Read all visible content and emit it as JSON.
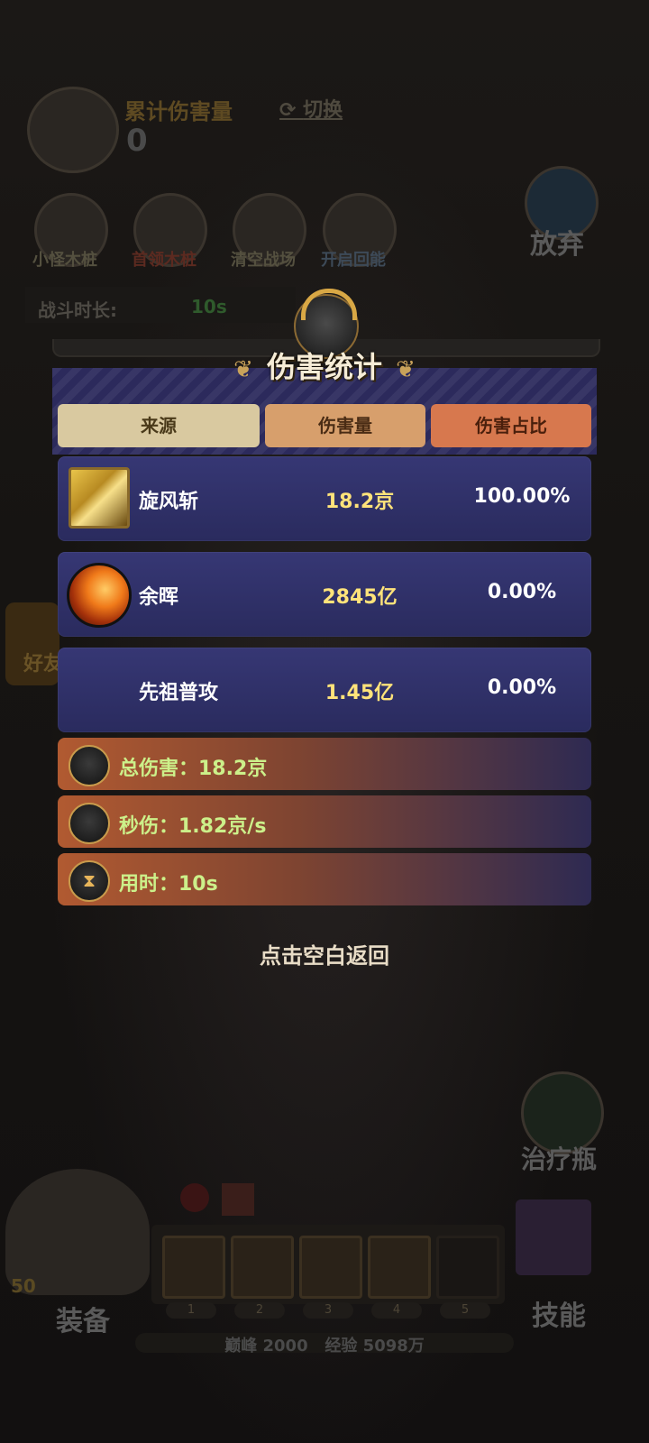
{
  "background": {
    "damage_label": "累计伤害量",
    "damage_value": "0",
    "switch_label": "切换",
    "top_buttons": [
      "小怪木桩",
      "首领木桩",
      "清空战场",
      "开启回能"
    ],
    "abandon_label": "放弃",
    "battle_time_label": "战斗时长:",
    "battle_time_value": "10s",
    "side_label": "好友",
    "potion_label": "治疗瓶",
    "equip_label": "装备",
    "skills_label": "技能",
    "level_badge": "50",
    "slot_numbers": [
      "1",
      "2",
      "3",
      "4",
      "5"
    ],
    "footer": "巅峰 2000   经验 5098万"
  },
  "panel": {
    "title": "伤害统计",
    "headers": [
      "来源",
      "伤害量",
      "伤害占比"
    ],
    "rows": [
      {
        "name": "旋风斩",
        "damage": "18.2京",
        "percent": "100.00%",
        "icon": "whirlwind-slash-icon"
      },
      {
        "name": "余晖",
        "damage": "2845亿",
        "percent": "0.00%",
        "icon": "afterglow-icon"
      },
      {
        "name": "先祖普攻",
        "damage": "1.45亿",
        "percent": "0.00%",
        "icon": ""
      }
    ],
    "stats": {
      "total": "总伤害：18.2京",
      "dps": "秒伤：1.82京/s",
      "time": "用时：10s"
    },
    "back_hint": "点击空白返回"
  },
  "colors": {
    "header_tab_1": "#d9c9a0",
    "header_tab_2": "#d79f6c",
    "header_tab_3": "#d7784e",
    "damage_value": "#ffe37a",
    "stat_text": "#ccf08a"
  }
}
